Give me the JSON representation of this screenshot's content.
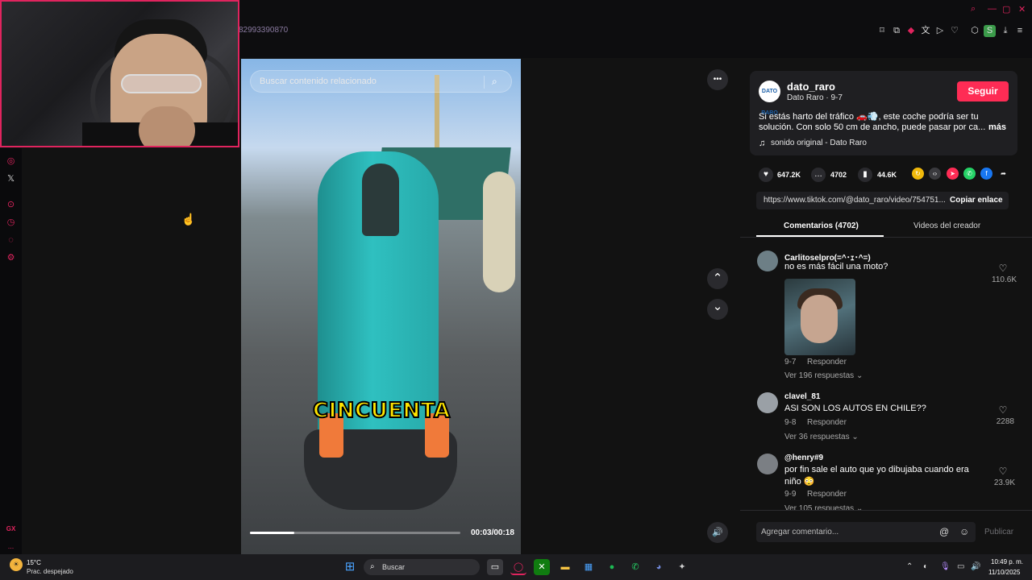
{
  "browser": {
    "url_fragment": "82993390870",
    "toolbar_icons": [
      "bookmark-icon",
      "tab-icon",
      "pocket-icon",
      "translate-icon",
      "send-icon",
      "heart-icon",
      "extensions-icon",
      "profile-icon",
      "download-icon",
      "menu-icon"
    ],
    "profile_letter": "S"
  },
  "sidebar": {
    "icons": [
      "instagram-icon",
      "x-icon",
      "play-circle-icon",
      "history-icon",
      "chat-icon",
      "settings-icon"
    ],
    "gx_label": "GX",
    "more_label": "..."
  },
  "video": {
    "search_placeholder": "Buscar contenido relacionado",
    "caption": "CINCUENTA",
    "time": "00:03/00:18",
    "progress": 0.21
  },
  "controls": {
    "more": "•••",
    "up": "⌃",
    "down": "⌄",
    "volume": "🔊"
  },
  "author": {
    "avatar_text": "DATO RARO",
    "handle": "dato_raro",
    "sub": "Dato Raro · 9-7",
    "follow_label": "Seguir",
    "desc_line1": "Si estás harto del tráfico 🚗💨, este coche podría ser tu",
    "desc_line2": "solución. Con solo 50 cm de ancho, puede pasar por ca...",
    "more_label": "más",
    "music": "sonido original - Dato Raro"
  },
  "stats": {
    "likes": "647.2K",
    "comments": "4702",
    "saves": "44.6K"
  },
  "share": {
    "link": "https://www.tiktok.com/@dato_raro/video/754751...",
    "copy_label": "Copiar enlace"
  },
  "tabs": {
    "comments": "Comentarios (4702)",
    "creator": "Videos del creador"
  },
  "comments": [
    {
      "user": "Carlitoselpro(=^･ｪ･^=)",
      "text": "no es más fácil una moto?",
      "date": "9-7",
      "reply": "Responder",
      "more": "Ver 196 respuestas ⌄",
      "likes": "110.6K"
    },
    {
      "user": "clavel_81",
      "text": "ASI SON LOS AUTOS EN CHILE??",
      "date": "9-8",
      "reply": "Responder",
      "more": "Ver 36 respuestas ⌄",
      "likes": "2288"
    },
    {
      "user": "@henry#9",
      "text": "por fin sale el auto que yo dibujaba cuando era",
      "text2": "niño 😳",
      "date": "9-9",
      "reply": "Responder",
      "more": "Ver 105 respuestas ⌄",
      "likes": "23.9K"
    }
  ],
  "comment_box": {
    "placeholder": "Agregar comentario...",
    "publish_label": "Publicar"
  },
  "taskbar": {
    "temp": "15°C",
    "weather": "Prac. despejado",
    "search_label": "Buscar",
    "time": "10:49 p. m.",
    "date": "11/10/2025"
  },
  "colors": {
    "accent": "#fe2c55",
    "opera_red": "#e0245e",
    "caption_yellow": "#ffe500",
    "car_teal": "#2fc0c0"
  }
}
